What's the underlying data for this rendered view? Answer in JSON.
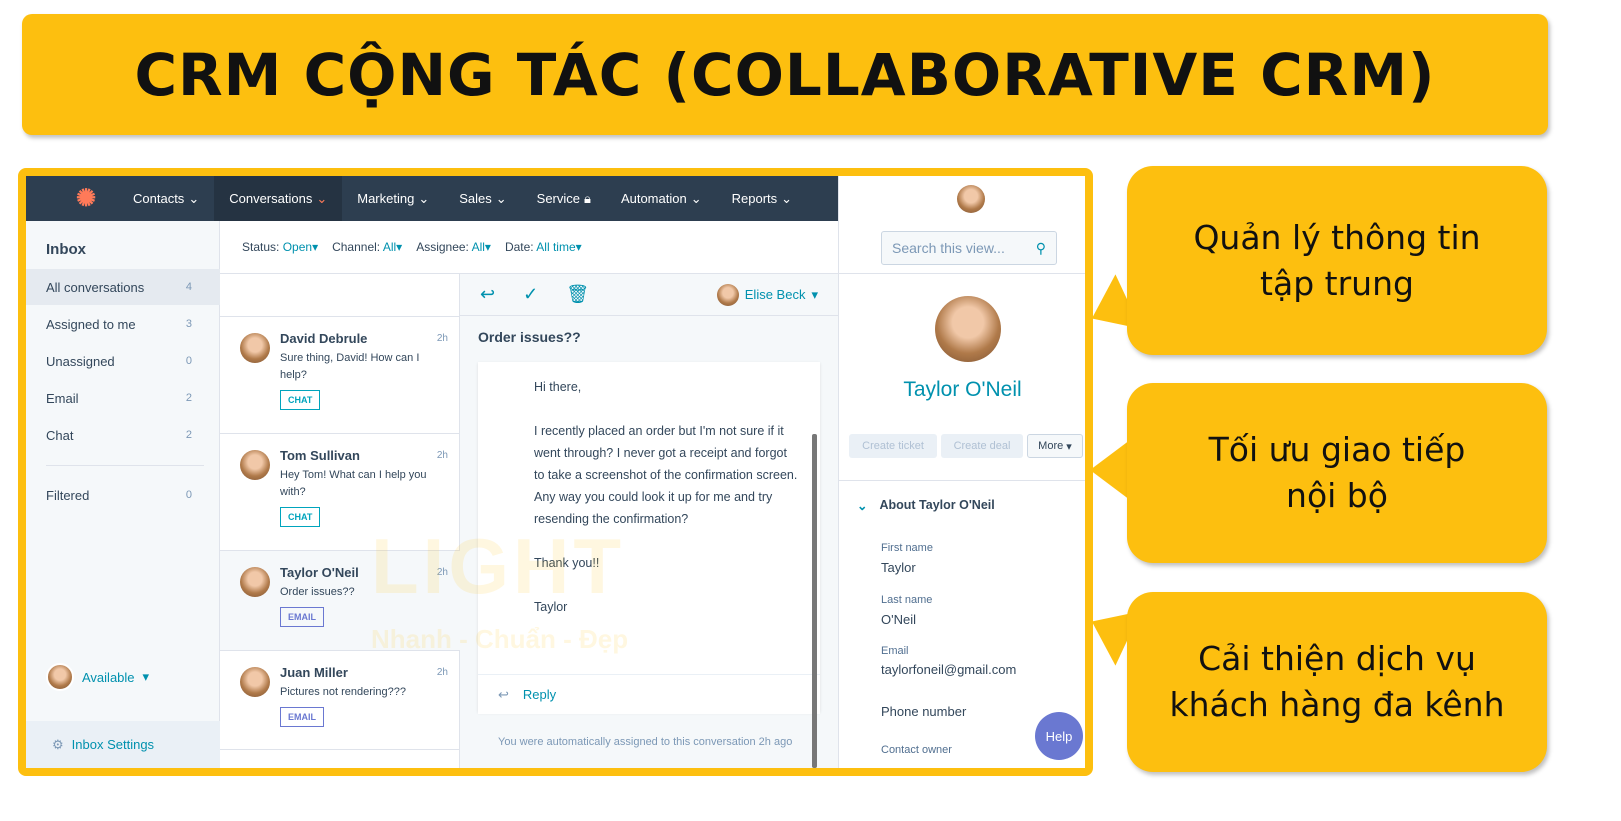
{
  "title": "CRM CỘNG TÁC (COLLABORATIVE CRM)",
  "callouts": [
    "Quản lý thông tin tập trung",
    "Tối ưu giao tiếp nội bộ",
    "Cải thiện dịch vụ khách hàng đa kênh"
  ],
  "watermark": {
    "logo": "LIGHT",
    "slogan": "Nhanh - Chuẩn - Đẹp"
  },
  "colors": {
    "accent": "#FDBF0F",
    "nav": "#2D3E50",
    "link": "#0091AE",
    "brand": "#FF7A59"
  },
  "nav": {
    "items": [
      "Contacts",
      "Conversations",
      "Marketing",
      "Sales",
      "Service",
      "Automation",
      "Reports"
    ]
  },
  "sidebar": {
    "title": "Inbox",
    "items": [
      {
        "label": "All conversations",
        "count": "4"
      },
      {
        "label": "Assigned to me",
        "count": "3"
      },
      {
        "label": "Unassigned",
        "count": "0"
      },
      {
        "label": "Email",
        "count": "2"
      },
      {
        "label": "Chat",
        "count": "2"
      },
      {
        "label": "Filtered",
        "count": "0"
      }
    ],
    "status": "Available",
    "settings": "Inbox Settings"
  },
  "filters": [
    {
      "label": "Status:",
      "value": "Open"
    },
    {
      "label": "Channel:",
      "value": "All"
    },
    {
      "label": "Assignee:",
      "value": "All"
    },
    {
      "label": "Date:",
      "value": "All time"
    }
  ],
  "search": {
    "placeholder": "Search this view..."
  },
  "conversations": [
    {
      "name": "David Debrule",
      "time": "2h",
      "preview": "Sure thing, David! How can I help?",
      "tag": "CHAT"
    },
    {
      "name": "Tom Sullivan",
      "time": "2h",
      "preview": "Hey Tom! What can I help you with?",
      "tag": "CHAT"
    },
    {
      "name": "Taylor O'Neil",
      "time": "2h",
      "preview": "Order issues??",
      "tag": "EMAIL"
    },
    {
      "name": "Juan Miller",
      "time": "2h",
      "preview": "Pictures not rendering???",
      "tag": "EMAIL"
    }
  ],
  "message": {
    "assignee": "Elise Beck",
    "subject": "Order issues??",
    "greeting": "Hi there,",
    "body": "I recently placed an order but I'm not sure if it went through? I never got a receipt and forgot to take a screenshot of the confirmation screen. Any way you could look it up for me and try resending the confirmation?",
    "thanks": "Thank you!!",
    "signature": "Taylor",
    "reply": "Reply",
    "system": "You were automatically assigned to this conversation 2h ago"
  },
  "contact": {
    "name": "Taylor O'Neil",
    "buttons": [
      "Create ticket",
      "Create deal",
      "More"
    ],
    "section": "About Taylor O'Neil",
    "fields": [
      {
        "label": "First name",
        "value": "Taylor"
      },
      {
        "label": "Last name",
        "value": "O'Neil"
      },
      {
        "label": "Email",
        "value": "taylorfoneil@gmail.com"
      },
      {
        "label": "Phone number",
        "value": ""
      },
      {
        "label": "Contact owner",
        "value": ""
      }
    ],
    "help": "Help"
  }
}
